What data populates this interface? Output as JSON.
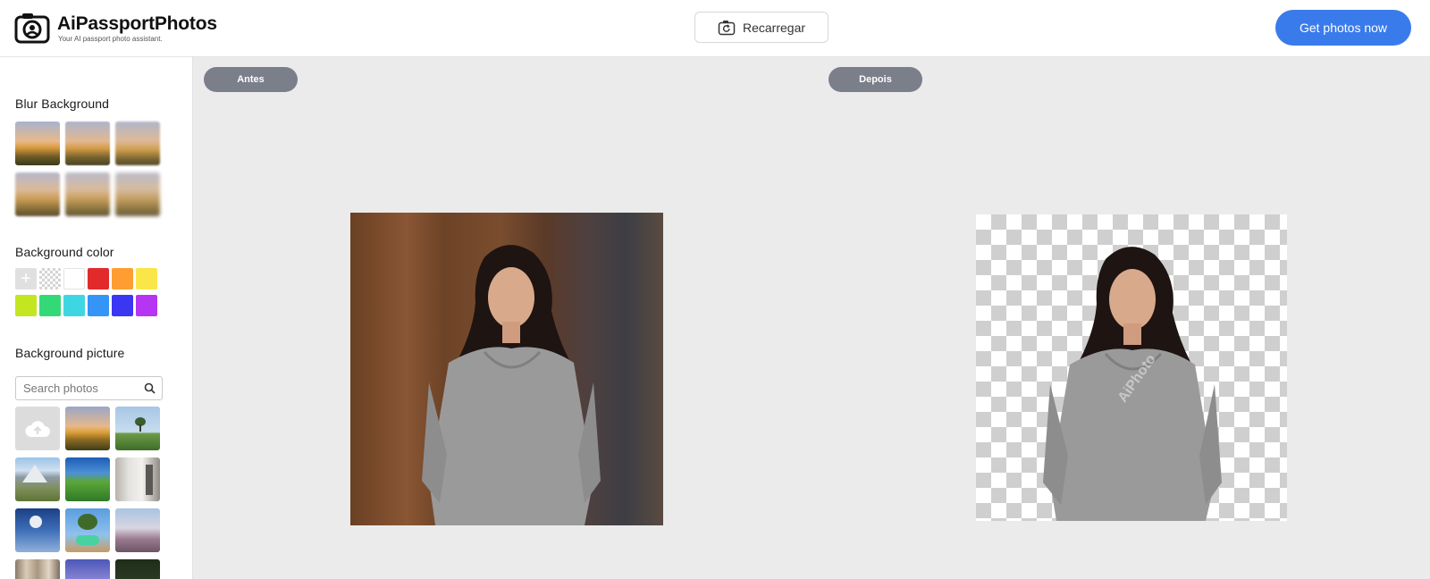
{
  "header": {
    "app_name": "AiPassportPhotos",
    "tagline": "Your AI passport photo assistant.",
    "reload_label": "Recarregar",
    "cta_label": "Get photos now"
  },
  "sidebar": {
    "blur_title": "Blur Background",
    "bgcolor_title": "Background color",
    "bgpicture_title": "Background picture",
    "search_placeholder": "Search photos",
    "colors": [
      "#e6e6e6",
      "checker",
      "#ffffff",
      "#e32a2a",
      "#ff9d33",
      "#fbe649",
      "#c3e621",
      "#33d977",
      "#3fd6e3",
      "#3595f7",
      "#3a36f2",
      "#b635f2"
    ]
  },
  "main": {
    "before_label": "Antes",
    "after_label": "Depois",
    "watermark": "AiPhoto"
  },
  "colors": {
    "accent": "#3a7bec",
    "pill": "#7a7f8a"
  }
}
